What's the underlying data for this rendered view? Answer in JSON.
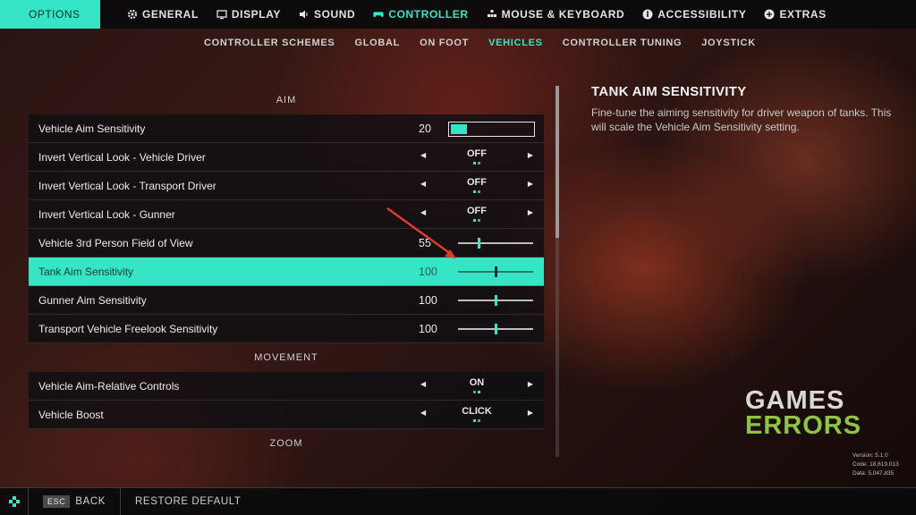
{
  "header": {
    "options_label": "OPTIONS",
    "tabs": [
      {
        "label": "GENERAL",
        "icon": "gear-icon"
      },
      {
        "label": "DISPLAY",
        "icon": "monitor-icon"
      },
      {
        "label": "SOUND",
        "icon": "speaker-icon"
      },
      {
        "label": "CONTROLLER",
        "icon": "gamepad-icon"
      },
      {
        "label": "MOUSE & KEYBOARD",
        "icon": "mouse-keyboard-icon"
      },
      {
        "label": "ACCESSIBILITY",
        "icon": "accessibility-icon"
      },
      {
        "label": "EXTRAS",
        "icon": "plus-icon"
      }
    ],
    "active_tab": "CONTROLLER"
  },
  "subtabs": {
    "items": [
      "CONTROLLER SCHEMES",
      "GLOBAL",
      "ON FOOT",
      "VEHICLES",
      "CONTROLLER TUNING",
      "JOYSTICK"
    ],
    "active": "VEHICLES"
  },
  "sections": {
    "aim": "AIM",
    "movement": "MOVEMENT",
    "zoom": "ZOOM"
  },
  "rows": {
    "r0": {
      "label": "Vehicle Aim Sensitivity",
      "value": "20",
      "fill": 0.2
    },
    "r1": {
      "label": "Invert Vertical Look - Vehicle Driver",
      "value": "OFF"
    },
    "r2": {
      "label": "Invert Vertical Look - Transport Driver",
      "value": "OFF"
    },
    "r3": {
      "label": "Invert Vertical Look - Gunner",
      "value": "OFF"
    },
    "r4": {
      "label": "Vehicle 3rd Person Field of View",
      "value": "55",
      "level": 0.27
    },
    "r5": {
      "label": "Tank Aim Sensitivity",
      "value": "100",
      "level": 0.5
    },
    "r6": {
      "label": "Gunner Aim Sensitivity",
      "value": "100",
      "level": 0.5
    },
    "r7": {
      "label": "Transport Vehicle Freelook Sensitivity",
      "value": "100",
      "level": 0.5
    },
    "r8": {
      "label": "Vehicle Aim-Relative Controls",
      "value": "ON"
    },
    "r9": {
      "label": "Vehicle Boost",
      "value": "CLICK"
    }
  },
  "description": {
    "title": "TANK AIM SENSITIVITY",
    "text": "Fine-tune the aiming sensitivity for driver weapon of tanks. This will scale the Vehicle Aim Sensitivity setting."
  },
  "watermark": {
    "line1": "GAMES",
    "line2": "ERRORS"
  },
  "version_info": {
    "version": "Version: 5.1.0",
    "code": "Code: 18,619,013",
    "data": "Data: 5,047,835"
  },
  "footer": {
    "back_key": "ESC",
    "back_label": "BACK",
    "restore_label": "RESTORE DEFAULT"
  },
  "colors": {
    "accent": "#35e6c6",
    "logo_green": "#8cc63f"
  }
}
